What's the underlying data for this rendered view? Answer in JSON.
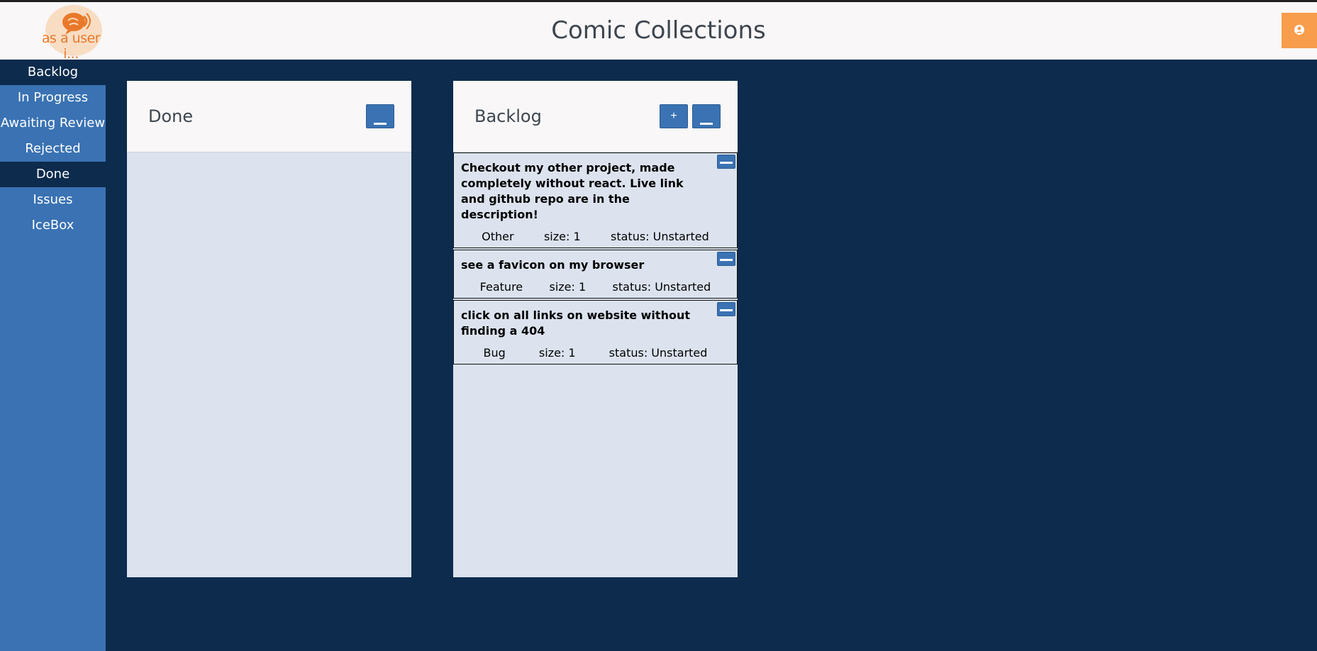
{
  "header": {
    "logo_text": "as a user i...",
    "title": "Comic Collections",
    "user_icon": "user-circle-icon"
  },
  "colors": {
    "background": "#0d2b4c",
    "sidebar": "#3a72b3",
    "accent": "#f79d4c"
  },
  "sidebar": {
    "items": [
      {
        "label": "Backlog",
        "active": true
      },
      {
        "label": "In Progress",
        "active": false
      },
      {
        "label": "Awaiting Review",
        "active": false
      },
      {
        "label": "Rejected",
        "active": false
      },
      {
        "label": "Done",
        "active": true
      },
      {
        "label": "Issues",
        "active": false
      },
      {
        "label": "IceBox",
        "active": false
      }
    ]
  },
  "columns": {
    "done": {
      "title": "Done",
      "minimize_icon": "minus-icon",
      "cards": []
    },
    "backlog": {
      "title": "Backlog",
      "add_label": "+",
      "minimize_icon": "minus-icon",
      "cards": [
        {
          "text": "Checkout my other project, made completely without react. Live link and github repo are in the description!",
          "type": "Other",
          "size": "size: 1",
          "status": "status: Unstarted"
        },
        {
          "text": "see a favicon on my browser",
          "type": "Feature",
          "size": "size: 1",
          "status": "status: Unstarted"
        },
        {
          "text": "click on all links on website without finding a 404",
          "type": "Bug",
          "size": "size: 1",
          "status": "status: Unstarted"
        }
      ]
    }
  }
}
